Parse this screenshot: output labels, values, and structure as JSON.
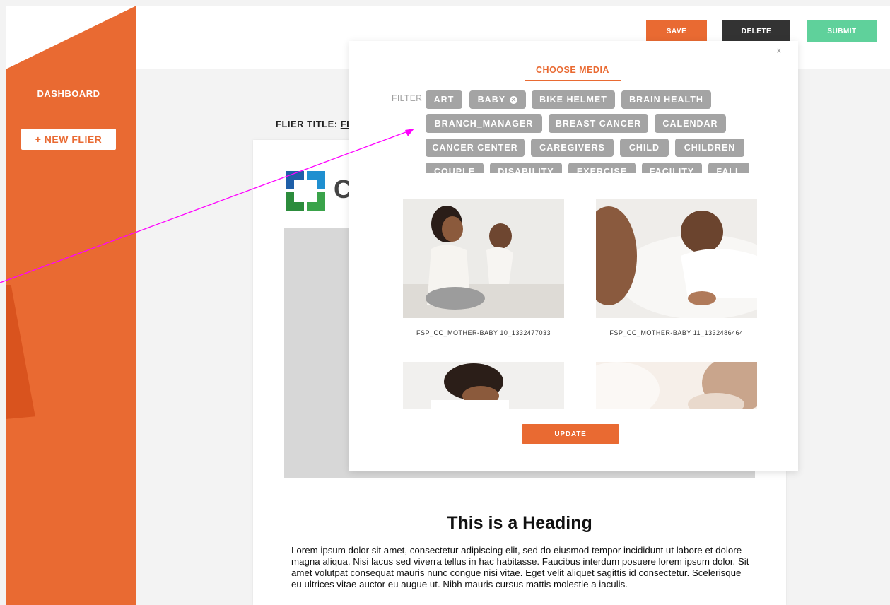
{
  "header": {
    "save_label": "SAVE",
    "delete_label": "DELETE",
    "submit_label": "SUBMIT"
  },
  "sidebar": {
    "dashboard_label": "DASHBOARD",
    "new_flier_label": "+ NEW FLIER"
  },
  "flier": {
    "title_label": "FLIER TITLE:",
    "title_value": "FL",
    "logo_letter": "C",
    "heading": "This is a Heading",
    "body": "Lorem ipsum dolor sit amet, consectetur adipiscing elit, sed do eiusmod tempor incididunt ut labore et dolore magna aliqua. Nisi lacus sed viverra tellus in hac habitasse. Faucibus interdum posuere lorem ipsum dolor. Sit amet volutpat consequat mauris nunc congue nisi vitae. Eget velit aliquet sagittis id consectetur. Scelerisque eu ultrices vitae auctor eu augue ut. Nibh mauris cursus mattis molestie a iaculis."
  },
  "modal": {
    "close_label": "×",
    "title": "CHOOSE MEDIA",
    "filter_label": "FILTER",
    "tags": [
      {
        "label": "ART"
      },
      {
        "label": "BABY",
        "selected": true
      },
      {
        "label": "BIKE HELMET"
      },
      {
        "label": "BRAIN HEALTH"
      },
      {
        "label": "BRANCH_MANAGER"
      },
      {
        "label": "BREAST CANCER"
      },
      {
        "label": "CALENDAR"
      },
      {
        "label": "CANCER CENTER"
      },
      {
        "label": "CAREGIVERS"
      },
      {
        "label": "CHILD"
      },
      {
        "label": "CHILDREN"
      },
      {
        "label": "COUPLE"
      },
      {
        "label": "DISABILITY"
      },
      {
        "label": "EXERCISE"
      },
      {
        "label": "FACILITY"
      },
      {
        "label": "FALL"
      }
    ],
    "media": [
      {
        "caption": "FSP_CC_MOTHER-BABY 10_1332477033"
      },
      {
        "caption": "FSP_CC_MOTHER-BABY 11_1332486464"
      }
    ],
    "update_label": "UPDATE"
  },
  "colors": {
    "accent": "#e96a32",
    "sidebar": "#e96a32",
    "delete": "#333333",
    "submit": "#5fd19b",
    "tag": "#a4a4a4",
    "annotation_arrow": "#ff00ff"
  }
}
